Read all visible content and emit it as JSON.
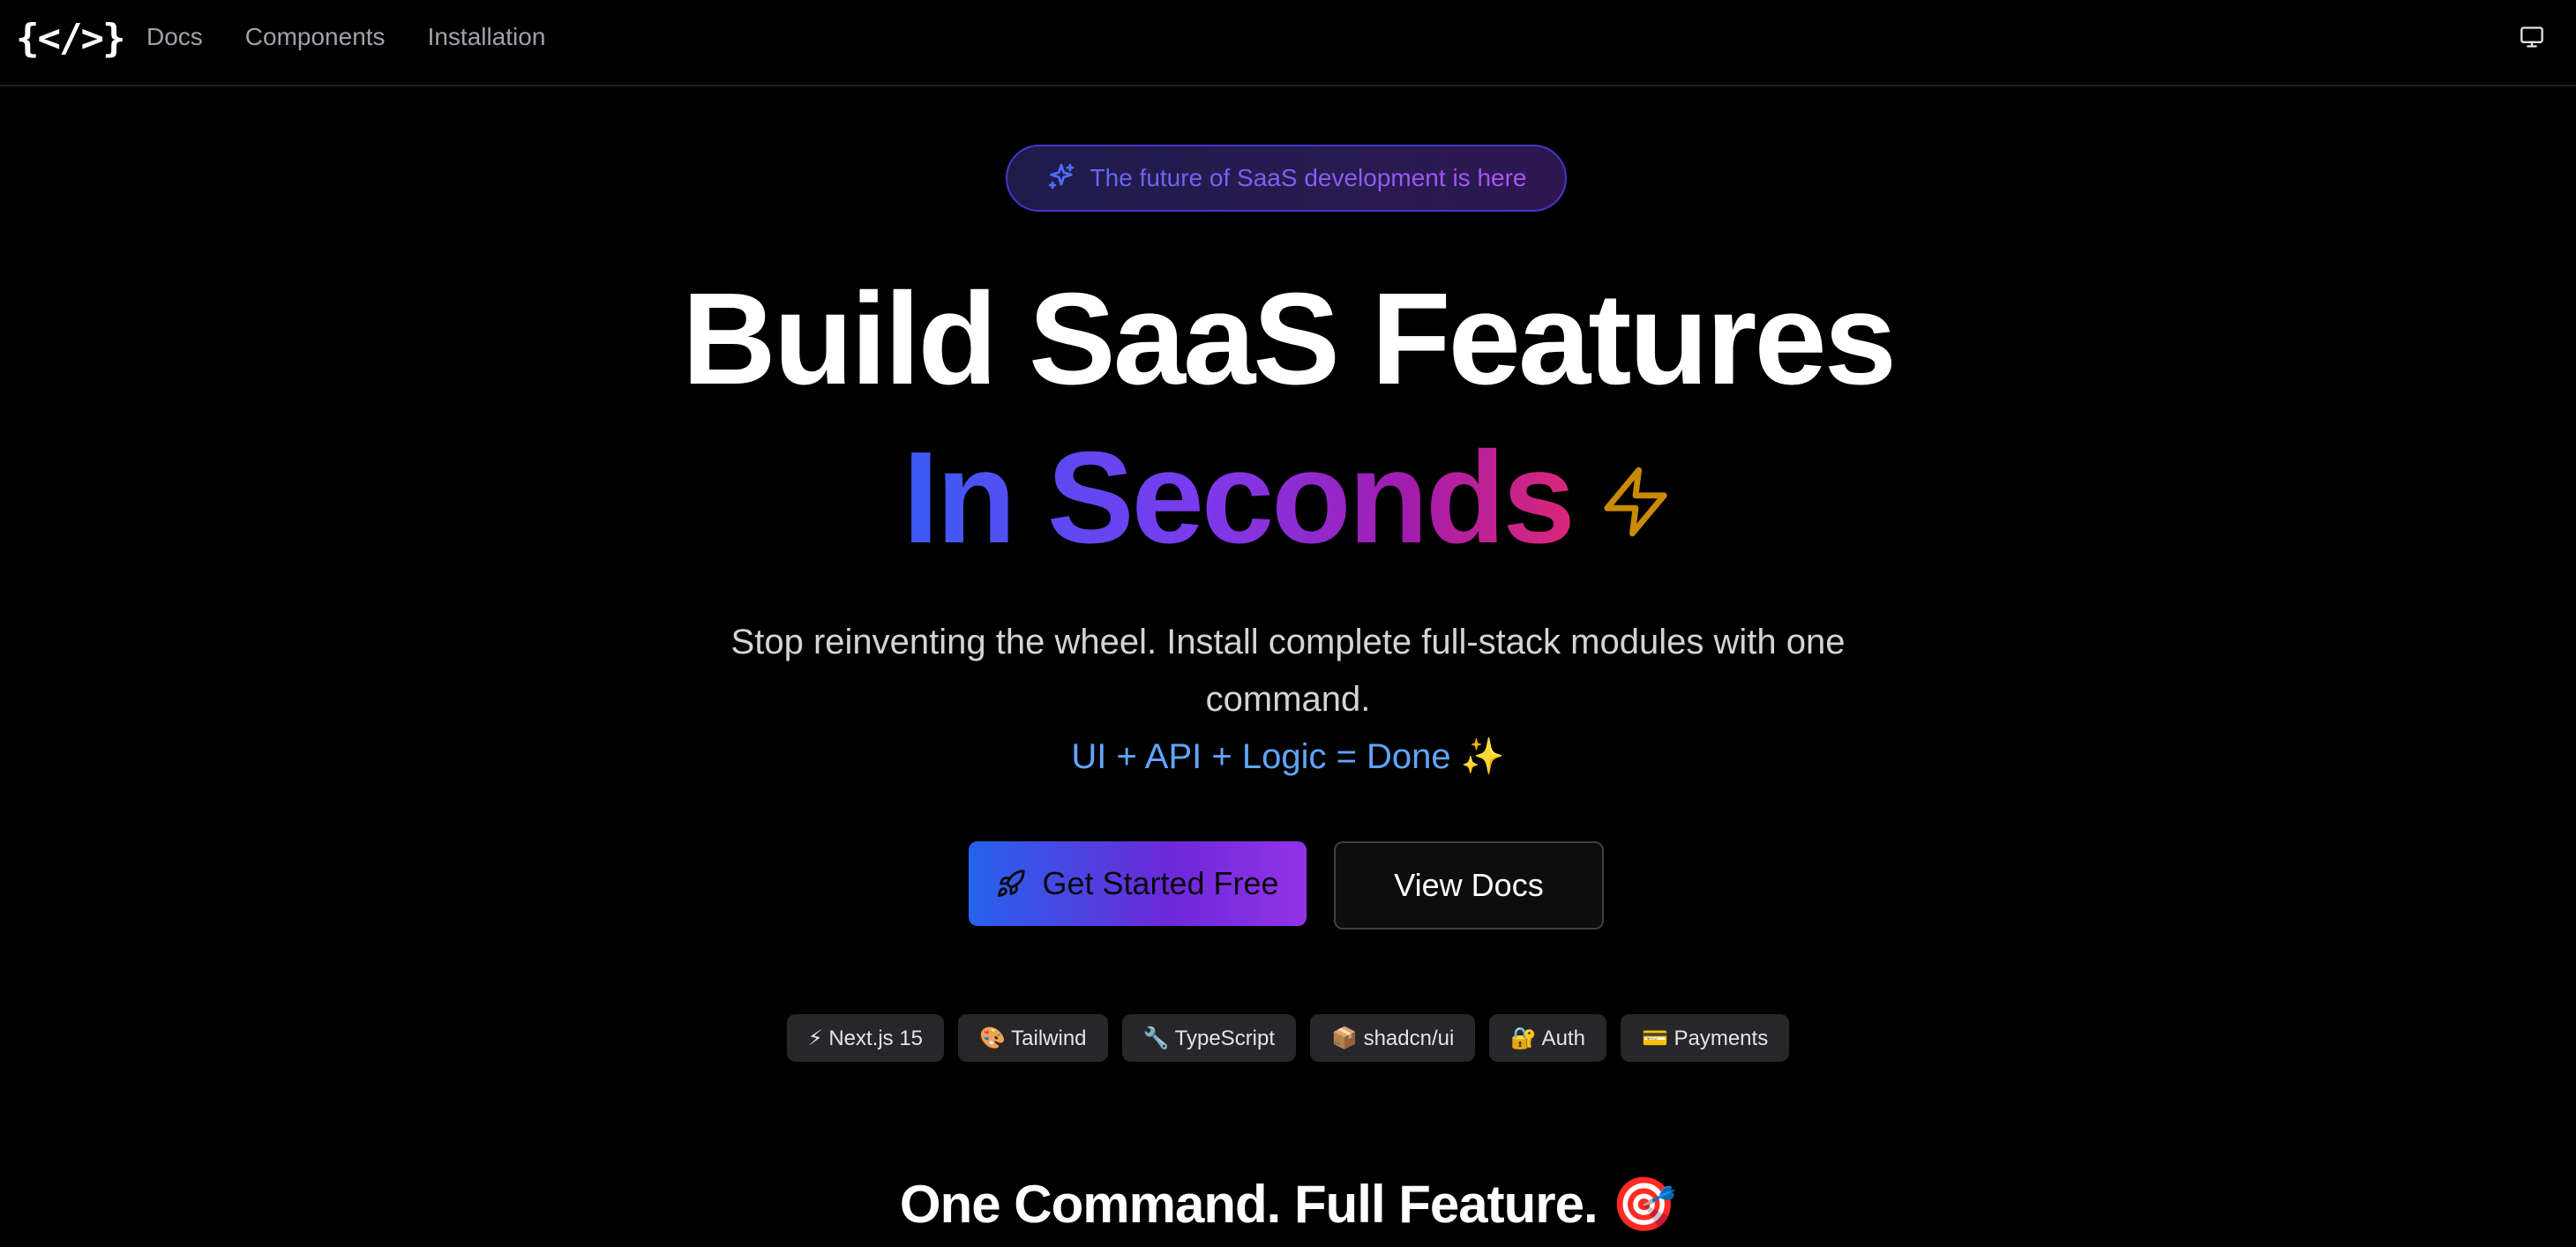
{
  "nav": {
    "logo": "{</>}",
    "links": [
      "Docs",
      "Components",
      "Installation"
    ],
    "theme_icon": "monitor-icon"
  },
  "hero": {
    "badge_text": "The future of SaaS development is here",
    "badge_icon": "sparkles-icon",
    "title_line1": "Build SaaS Features",
    "title_line2": "In Seconds",
    "title_icon": "lightning-bolt-icon",
    "subtitle": "Stop reinventing the wheel. Install complete full-stack modules with one command.",
    "tagline": "UI + API + Logic = Done ✨",
    "primary_button": "Get Started Free",
    "primary_button_icon": "rocket-icon",
    "secondary_button": "View Docs"
  },
  "tech_pills": [
    "⚡ Next.js 15",
    "🎨 Tailwind",
    "🔧 TypeScript",
    "📦 shadcn/ui",
    "🔐 Auth",
    "💳 Payments"
  ],
  "section": {
    "title": "One Command. Full Feature. 🎯"
  },
  "colors": {
    "background": "#000000",
    "accent_blue": "#60a5fa",
    "accent_purple": "#9333ea",
    "bolt_yellow": "#ca8a04",
    "pill_bg": "#27272a"
  }
}
